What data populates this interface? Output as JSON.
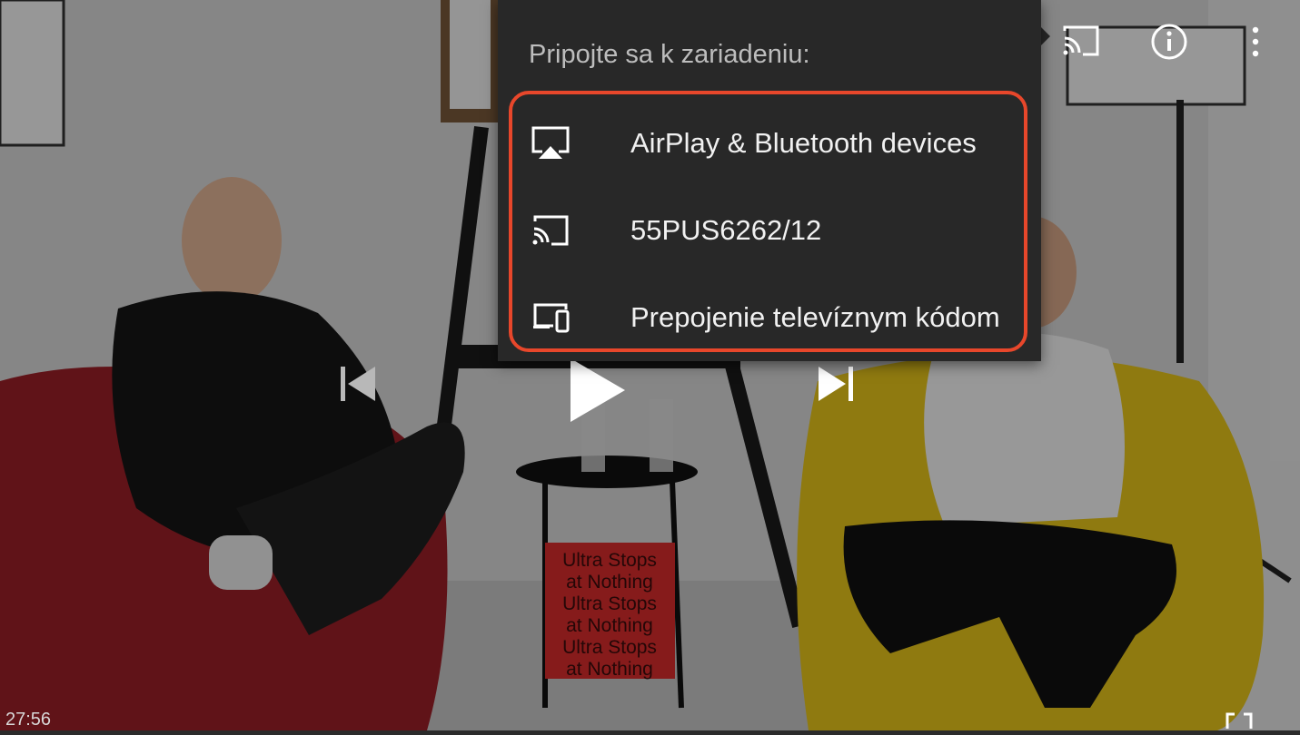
{
  "menu": {
    "title": "Pripojte sa k zariadeniu:",
    "devices": [
      {
        "label": "AirPlay & Bluetooth devices",
        "icon": "airplay-icon"
      },
      {
        "label": "55PUS6262/12",
        "icon": "cast-icon"
      },
      {
        "label": "Prepojenie televíznym kódom",
        "icon": "tv-code-icon"
      }
    ],
    "highlight_color": "#e8472b"
  },
  "player": {
    "current_time": "27:56",
    "top_icons": [
      "cast-icon",
      "info-icon",
      "more-vert-icon"
    ],
    "controls": [
      "previous-icon",
      "play-icon",
      "next-icon"
    ]
  },
  "video_frame": {
    "book_text_lines": [
      "Ultra Stops",
      "at Nothing",
      "Ultra Stops",
      "at Nothing",
      "Ultra Stops",
      "at Nothing"
    ]
  }
}
